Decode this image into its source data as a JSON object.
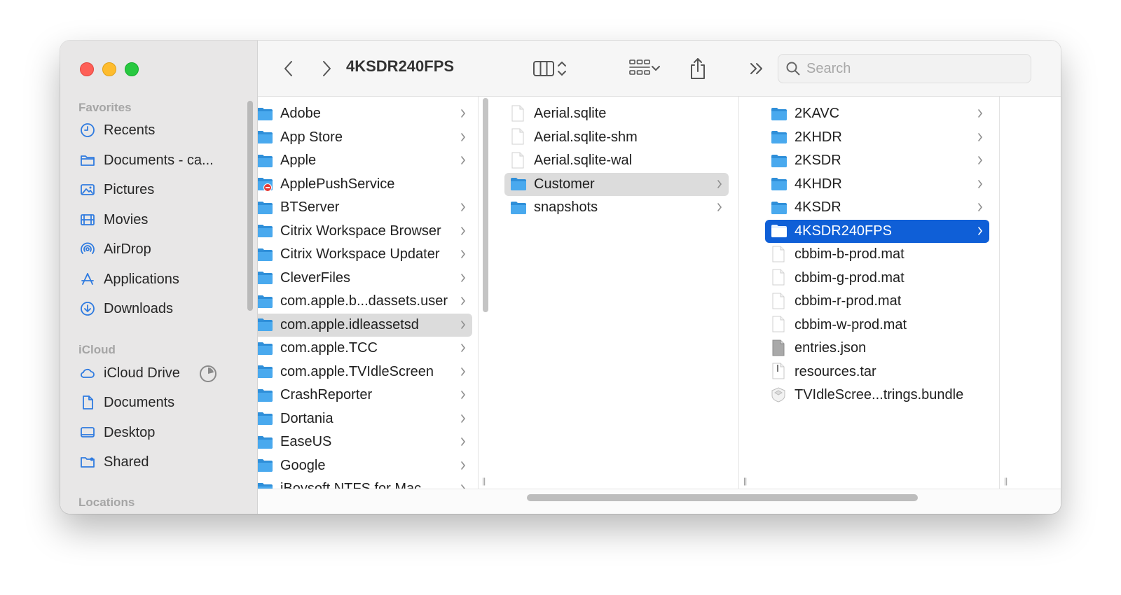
{
  "window": {
    "title": "4KSDR240FPS"
  },
  "toolbar": {
    "search_placeholder": "Search",
    "icons": [
      "back-chevron-icon",
      "forward-chevron-icon",
      "column-view-icon",
      "group-grid-icon",
      "share-icon",
      "more-chevrons-icon",
      "search-icon"
    ]
  },
  "sidebar": {
    "favorites_heading": "Favorites",
    "favorites": [
      {
        "label": "Recents",
        "icon": "clock-icon"
      },
      {
        "label": "Documents - ca...",
        "icon": "folder-icon"
      },
      {
        "label": "Pictures",
        "icon": "photo-icon"
      },
      {
        "label": "Movies",
        "icon": "film-icon"
      },
      {
        "label": "AirDrop",
        "icon": "airdrop-icon"
      },
      {
        "label": "Applications",
        "icon": "apps-icon"
      },
      {
        "label": "Downloads",
        "icon": "download-icon"
      }
    ],
    "icloud_heading": "iCloud",
    "icloud": [
      {
        "label": "iCloud Drive",
        "icon": "cloud-icon"
      },
      {
        "label": "Documents",
        "icon": "doc-icon"
      },
      {
        "label": "Desktop",
        "icon": "desktop-icon"
      },
      {
        "label": "Shared",
        "icon": "shared-folder-icon"
      }
    ],
    "locations_heading": "Locations"
  },
  "columns": {
    "col1": [
      {
        "label": "Adobe",
        "type": "folder",
        "chevron": true
      },
      {
        "label": "App Store",
        "type": "folder",
        "chevron": true
      },
      {
        "label": "Apple",
        "type": "folder",
        "chevron": true
      },
      {
        "label": "ApplePushService",
        "type": "folder-restricted",
        "chevron": false
      },
      {
        "label": "BTServer",
        "type": "folder",
        "chevron": true
      },
      {
        "label": "Citrix Workspace Browser",
        "type": "folder",
        "chevron": true
      },
      {
        "label": "Citrix Workspace Updater",
        "type": "folder",
        "chevron": true
      },
      {
        "label": "CleverFiles",
        "type": "folder",
        "chevron": true
      },
      {
        "label": "com.apple.b...dassets.user",
        "type": "folder",
        "chevron": true
      },
      {
        "label": "com.apple.idleassetsd",
        "type": "folder",
        "chevron": true,
        "selected": "gray"
      },
      {
        "label": "com.apple.TCC",
        "type": "folder",
        "chevron": true
      },
      {
        "label": "com.apple.TVIdleScreen",
        "type": "folder",
        "chevron": true
      },
      {
        "label": "CrashReporter",
        "type": "folder",
        "chevron": true
      },
      {
        "label": "Dortania",
        "type": "folder",
        "chevron": true
      },
      {
        "label": "EaseUS",
        "type": "folder",
        "chevron": true
      },
      {
        "label": "Google",
        "type": "folder",
        "chevron": true
      },
      {
        "label": "iBoysoft NTFS for Mac",
        "type": "folder",
        "chevron": true
      }
    ],
    "col2": [
      {
        "label": "Aerial.sqlite",
        "type": "file",
        "chevron": false
      },
      {
        "label": "Aerial.sqlite-shm",
        "type": "file",
        "chevron": false
      },
      {
        "label": "Aerial.sqlite-wal",
        "type": "file",
        "chevron": false
      },
      {
        "label": "Customer",
        "type": "folder",
        "chevron": true,
        "selected": "gray"
      },
      {
        "label": "snapshots",
        "type": "folder",
        "chevron": true
      }
    ],
    "col3": [
      {
        "label": "2KAVC",
        "type": "folder",
        "chevron": true
      },
      {
        "label": "2KHDR",
        "type": "folder",
        "chevron": true
      },
      {
        "label": "2KSDR",
        "type": "folder",
        "chevron": true
      },
      {
        "label": "4KHDR",
        "type": "folder",
        "chevron": true
      },
      {
        "label": "4KSDR",
        "type": "folder",
        "chevron": true
      },
      {
        "label": "4KSDR240FPS",
        "type": "folder",
        "chevron": true,
        "selected": "blue"
      },
      {
        "label": "cbbim-b-prod.mat",
        "type": "file",
        "chevron": false
      },
      {
        "label": "cbbim-g-prod.mat",
        "type": "file",
        "chevron": false
      },
      {
        "label": "cbbim-r-prod.mat",
        "type": "file",
        "chevron": false
      },
      {
        "label": "cbbim-w-prod.mat",
        "type": "file",
        "chevron": false
      },
      {
        "label": "entries.json",
        "type": "file-json",
        "chevron": false
      },
      {
        "label": "resources.tar",
        "type": "file-tar",
        "chevron": false
      },
      {
        "label": "TVIdleScree...trings.bundle",
        "type": "bundle",
        "chevron": false
      }
    ]
  },
  "colors": {
    "accent": "#0f5fd7",
    "folder": "#49a9ee",
    "sidebar_bg": "#e8e7e7",
    "sidebar_icon": "#2f7be0"
  }
}
